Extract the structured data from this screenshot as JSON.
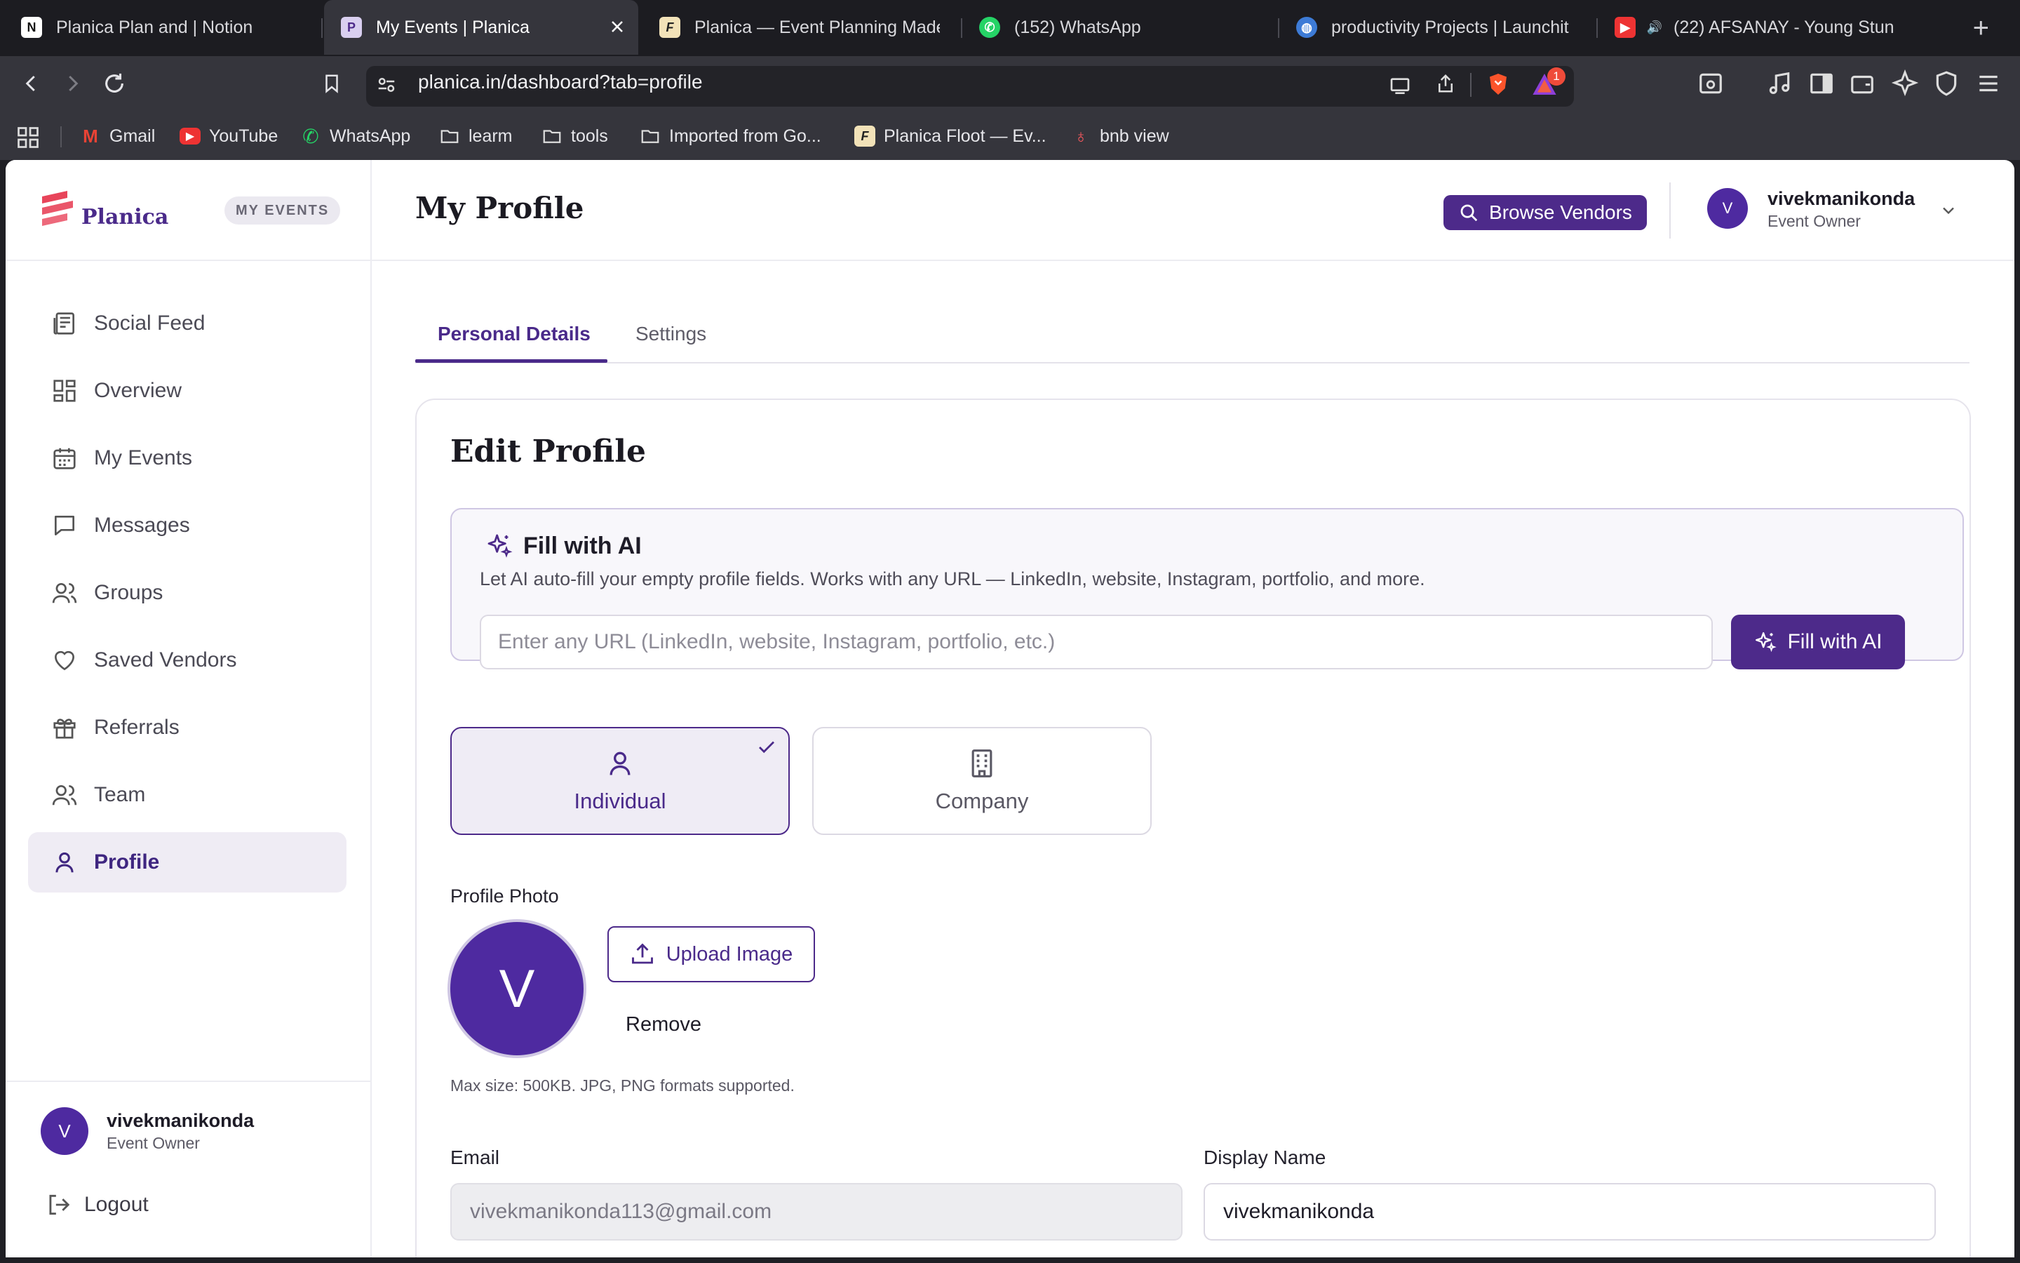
{
  "browser": {
    "tabs": [
      {
        "title": "Planica Plan and | Notion",
        "icon": "notion-icon"
      },
      {
        "title": "My Events | Planica",
        "icon": "planica-icon"
      },
      {
        "title": "Planica — Event Planning Made",
        "icon": "floot-icon"
      },
      {
        "title": "(152) WhatsApp",
        "icon": "whatsapp-icon"
      },
      {
        "title": "productivity Projects | Launchit",
        "icon": "globe-icon"
      },
      {
        "title": "(22) AFSANAY - Young Stun",
        "icon": "youtube-icon"
      }
    ],
    "url": "planica.in/dashboard?tab=profile",
    "shield_badge": "1",
    "bookmarks": [
      {
        "label": "Gmail"
      },
      {
        "label": "YouTube"
      },
      {
        "label": "WhatsApp"
      },
      {
        "label": "learm"
      },
      {
        "label": "tools"
      },
      {
        "label": "Imported from Go..."
      },
      {
        "label": "Planica Floot — Ev..."
      },
      {
        "label": "bnb view"
      }
    ]
  },
  "sidebar": {
    "brand": "Planica",
    "badge": "MY EVENTS",
    "items": [
      {
        "label": "Social Feed",
        "icon": "feed-icon"
      },
      {
        "label": "Overview",
        "icon": "grid-icon"
      },
      {
        "label": "My Events",
        "icon": "calendar-icon"
      },
      {
        "label": "Messages",
        "icon": "message-icon"
      },
      {
        "label": "Groups",
        "icon": "users-icon"
      },
      {
        "label": "Saved Vendors",
        "icon": "heart-icon"
      },
      {
        "label": "Referrals",
        "icon": "gift-icon"
      },
      {
        "label": "Team",
        "icon": "team-icon"
      },
      {
        "label": "Profile",
        "icon": "user-icon",
        "active": true
      }
    ],
    "user": {
      "initial": "V",
      "name": "vivekmanikonda",
      "role": "Event Owner"
    },
    "logout": "Logout"
  },
  "header": {
    "title": "My Profile",
    "browse_vendors": "Browse Vendors",
    "user": {
      "initial": "V",
      "name": "vivekmanikonda",
      "role": "Event Owner"
    }
  },
  "profile_tabs": [
    {
      "label": "Personal Details",
      "active": true
    },
    {
      "label": "Settings",
      "active": false
    }
  ],
  "edit_profile": {
    "title": "Edit Profile",
    "ai": {
      "title": "Fill with AI",
      "description": "Let AI auto-fill your empty profile fields. Works with any URL — LinkedIn, website, Instagram, portfolio, and more.",
      "placeholder": "Enter any URL (LinkedIn, website, Instagram, portfolio, etc.)",
      "button": "Fill with AI"
    },
    "account_types": [
      {
        "label": "Individual",
        "selected": true
      },
      {
        "label": "Company",
        "selected": false
      }
    ],
    "photo": {
      "label": "Profile Photo",
      "initial": "V",
      "upload": "Upload Image",
      "remove": "Remove",
      "hint": "Max size: 500KB. JPG, PNG formats supported."
    },
    "email": {
      "label": "Email",
      "value": "vivekmanikonda113@gmail.com"
    },
    "display_name": {
      "label": "Display Name",
      "value": "vivekmanikonda"
    }
  },
  "colors": {
    "brand": "#4d2a8a",
    "accent_soft": "#efecf5",
    "chrome_dark": "#35353c"
  }
}
